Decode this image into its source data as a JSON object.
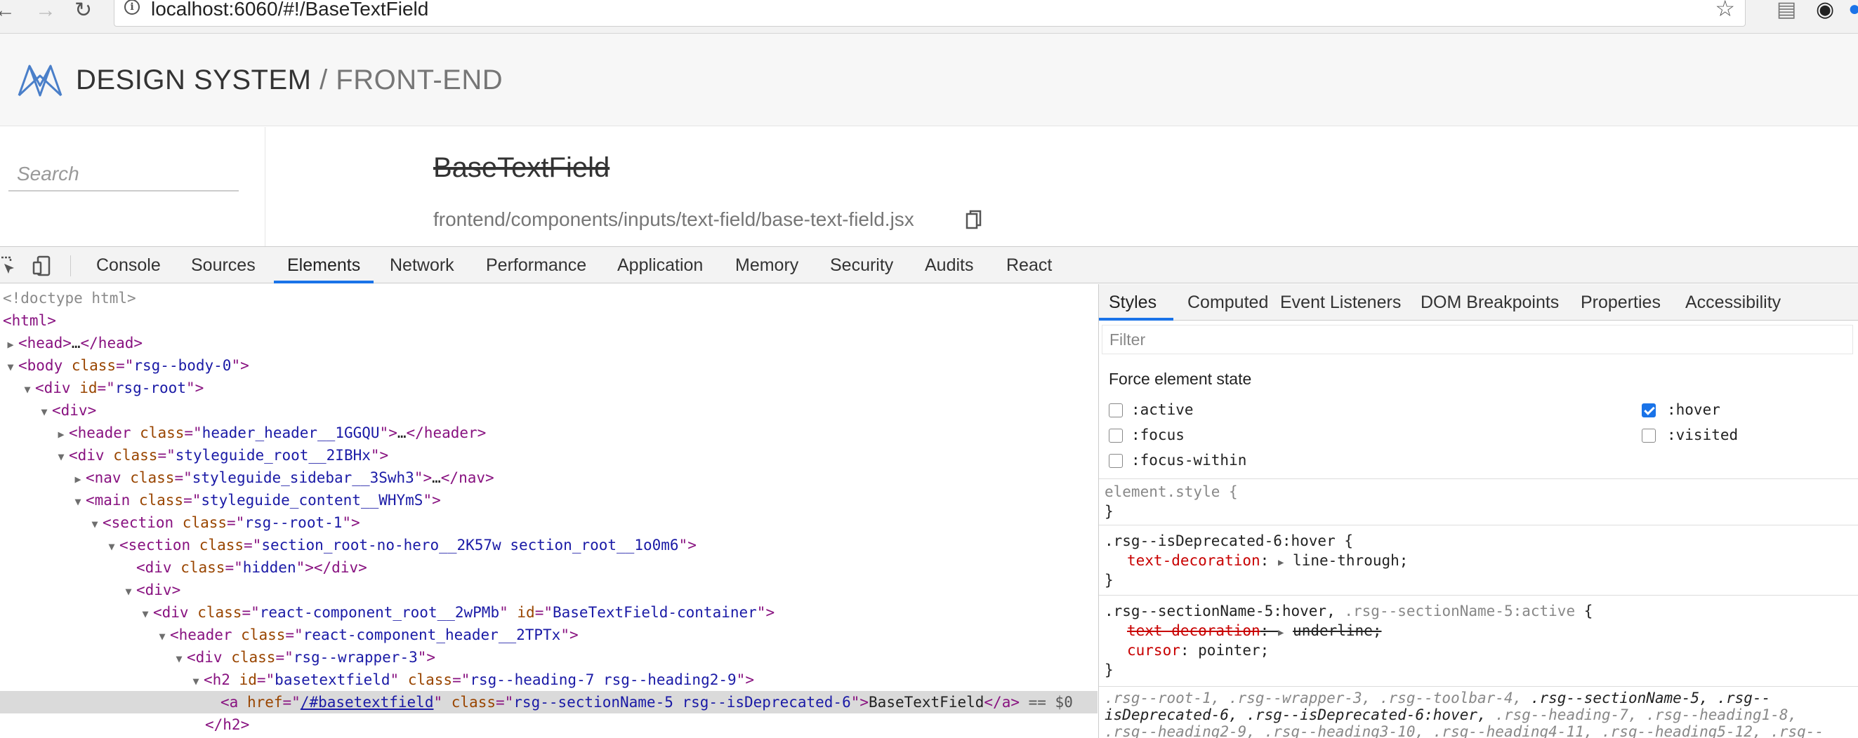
{
  "browser": {
    "url": "localhost:6060/#!/BaseTextField"
  },
  "site": {
    "brand": "DESIGN SYSTEM",
    "separator": " / ",
    "sub": "FRONT-END"
  },
  "sidebar": {
    "search_placeholder": "Search"
  },
  "content": {
    "title": "BaseTextField",
    "path": "frontend/components/inputs/text-field/base-text-field.jsx"
  },
  "devtools": {
    "tabs": [
      "Console",
      "Sources",
      "Elements",
      "Network",
      "Performance",
      "Application",
      "Memory",
      "Security",
      "Audits",
      "React"
    ],
    "active_tab": "Elements"
  },
  "elements": {
    "doctype": "<!doctype html>",
    "lines": [
      {
        "t0": "<html>"
      },
      {
        "t0": "<head>",
        "t1": "…",
        "t2": "</head>"
      },
      {
        "t0": "<body ",
        "a0": "class",
        "v0": "rsg--body-0",
        "t1": ">"
      },
      {
        "t0": "<div ",
        "a0": "id",
        "v0": "rsg-root",
        "t1": ">"
      },
      {
        "t0": "<div>"
      },
      {
        "t0": "<header ",
        "a0": "class",
        "v0": "header_header__1GGQU",
        "t1": ">",
        "t2": "…",
        "t3": "</header>"
      },
      {
        "t0": "<div ",
        "a0": "class",
        "v0": "styleguide_root__2IBHx",
        "t1": ">"
      },
      {
        "t0": "<nav ",
        "a0": "class",
        "v0": "styleguide_sidebar__3Swh3",
        "t1": ">",
        "t2": "…",
        "t3": "</nav>"
      },
      {
        "t0": "<main ",
        "a0": "class",
        "v0": "styleguide_content__WHYmS",
        "t1": ">"
      },
      {
        "t0": "<section ",
        "a0": "class",
        "v0": "rsg--root-1",
        "t1": ">"
      },
      {
        "t0": "<section ",
        "a0": "class",
        "v0": "section_root-no-hero__2K57w section_root__1o0m6",
        "t1": ">"
      },
      {
        "t0": "<div ",
        "a0": "class",
        "v0": "hidden",
        "t1": "></div>"
      },
      {
        "t0": "<div>"
      },
      {
        "t0": "<div ",
        "a0": "class",
        "v0": "react-component_root__2wPMb",
        "a1": "id",
        "v1": "BaseTextField-container",
        "t1": ">"
      },
      {
        "t0": "<header ",
        "a0": "class",
        "v0": "react-component_header__2TPTx",
        "t1": ">"
      },
      {
        "t0": "<div ",
        "a0": "class",
        "v0": "rsg--wrapper-3",
        "t1": ">"
      },
      {
        "t0": "<h2 ",
        "a0": "id",
        "v0": "basetextfield",
        "a1": "class",
        "v1": "rsg--heading-7 rsg--heading2-9",
        "t1": ">"
      },
      {
        "t0": "<a ",
        "a0": "href",
        "v0": "/#basetextfield",
        "a1": "class",
        "v1": "rsg--sectionName-5 rsg--isDeprecated-6",
        "t1": ">",
        "txt": "BaseTextField",
        "t2": "</a>",
        "eq": " == $0"
      },
      {
        "t0": "</h2>"
      }
    ]
  },
  "styles_pane": {
    "tabs": [
      "Styles",
      "Computed",
      "Event Listeners",
      "DOM Breakpoints",
      "Properties",
      "Accessibility"
    ],
    "filter_placeholder": "Filter",
    "force_state_title": "Force element state",
    "states": [
      {
        "label": ":active",
        "checked": false
      },
      {
        "label": ":hover",
        "checked": true
      },
      {
        "label": ":focus",
        "checked": false
      },
      {
        "label": ":visited",
        "checked": false
      },
      {
        "label": ":focus-within",
        "checked": false
      }
    ],
    "rules": {
      "element_style": "element.style {",
      "close": "}",
      "r1_selector": ".rsg--isDeprecated-6:hover {",
      "r1_prop": "text-decoration",
      "r1_val": "line-through;",
      "r2_selector_a": ".rsg--sectionName-5:hover, ",
      "r2_selector_b": ".rsg--sectionName-5:active",
      "r2_open": " {",
      "r2_prop1": "text-decoration",
      "r2_val1": "underline;",
      "r2_prop2": "cursor",
      "r2_val2": "pointer;",
      "r3_line1_a": ".rsg--root-1, .rsg--wrapper-3, .rsg--toolbar-4, ",
      "r3_line1_b": ".rsg--sectionName-5, .rsg--",
      "r3_line2_a": "isDeprecated-6, .rsg--isDeprecated-6:hover, ",
      "r3_line2_b": ".rsg--heading-7, .rsg--heading1-8,",
      "r3_line3": ".rsg--heading2-9, .rsg--heading3-10, .rsg--heading4-11, .rsg--heading5-12, .rsg--"
    }
  }
}
